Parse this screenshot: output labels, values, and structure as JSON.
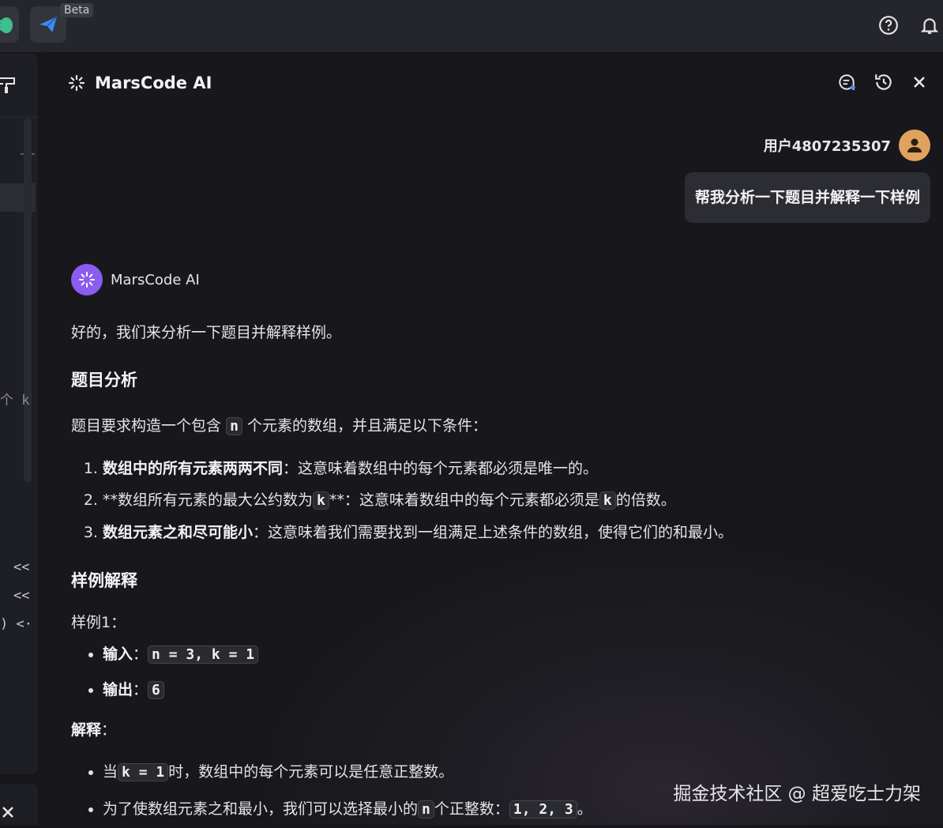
{
  "topbar": {
    "beta_label": "Beta"
  },
  "left_panel": {
    "fragments": [
      "个 k",
      "<<",
      "<<",
      ") <·"
    ]
  },
  "panel": {
    "title": "MarsCode AI"
  },
  "user": {
    "name": "用户4807235307",
    "message": "帮我分析一下题目并解释一下样例"
  },
  "bot": {
    "name": "MarsCode AI"
  },
  "answer": {
    "intro": "好的，我们来分析一下题目并解释样例。",
    "h1": "题目分析",
    "p1_pre": "题目要求构造一个包含",
    "p1_code": "n",
    "p1_post": "个元素的数组，并且满足以下条件：",
    "li1_bold": "数组中的所有元素两两不同",
    "li1_rest": "：这意味着数组中的每个元素都必须是唯一的。",
    "li2_pre": "**数组所有元素的最大公约数为",
    "li2_code": "k",
    "li2_mid": "**：这意味着数组中的每个元素都必须是",
    "li2_code2": "k",
    "li2_post": "的倍数。",
    "li3_bold": "数组元素之和尽可能小",
    "li3_rest": "：这意味着我们需要找到一组满足上述条件的数组，使得它们的和最小。",
    "h2": "样例解释",
    "sample_label": "样例1：",
    "input_label": "输入",
    "input_code": "n = 3, k = 1",
    "output_label": "输出",
    "output_code": "6",
    "explain_label": "解释",
    "b1_pre": "当",
    "b1_code": "k = 1",
    "b1_post": "时，数组中的每个元素可以是任意正整数。",
    "b2_pre": "为了使数组元素之和最小，我们可以选择最小的",
    "b2_code": "n",
    "b2_mid": "个正整数：",
    "b2_code2": "1, 2, 3",
    "b2_post": "。"
  },
  "watermark": "掘金技术社区 @ 超爱吃士力架"
}
